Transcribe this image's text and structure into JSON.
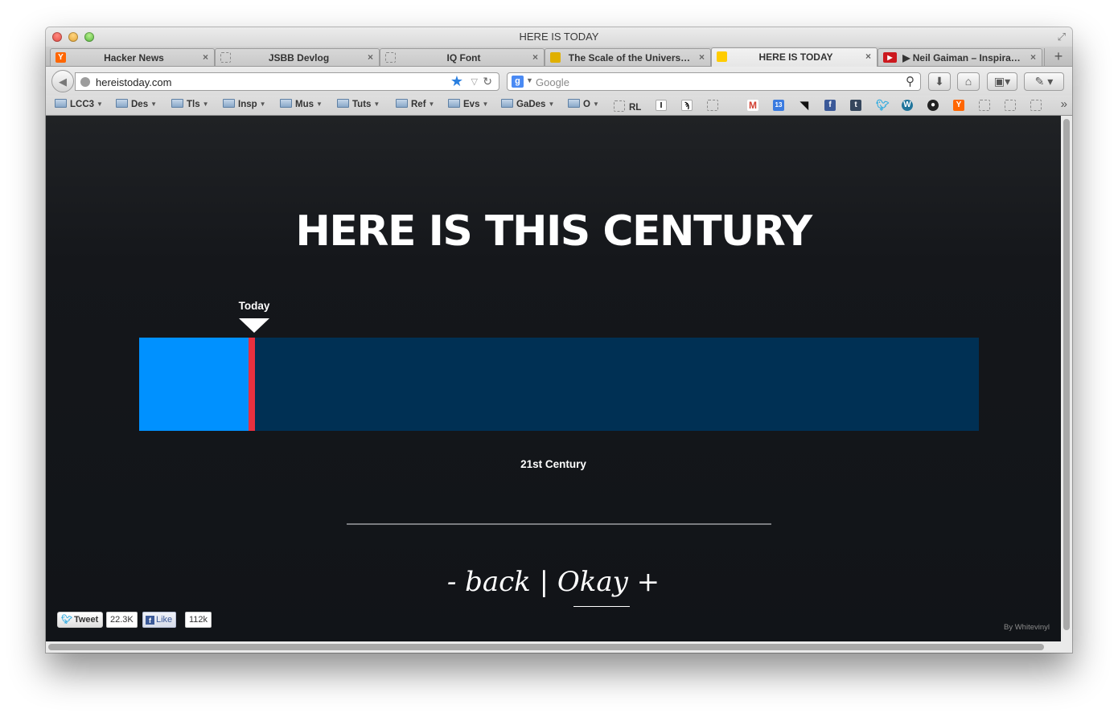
{
  "window": {
    "title": "HERE IS TODAY"
  },
  "tabs": [
    {
      "label": "Hacker News",
      "favicon": "Y",
      "favicon_color": "#ff6600"
    },
    {
      "label": "JSBB Devlog",
      "favicon": "",
      "favicon_color": ""
    },
    {
      "label": "IQ Font",
      "favicon": "",
      "favicon_color": ""
    },
    {
      "label": "The Scale of the Univers…",
      "favicon": "",
      "favicon_color": "#e0b000"
    },
    {
      "label": "HERE IS TODAY",
      "favicon": "",
      "favicon_color": "#ffcc00"
    },
    {
      "label": "▶ Neil Gaiman – Inspira…",
      "favicon": "▶",
      "favicon_color": "#cc181e"
    }
  ],
  "navbar": {
    "url": "hereistoday.com",
    "search_placeholder": "Google"
  },
  "bookmarks": {
    "folders": [
      "LCC3",
      "Des",
      "Tls",
      "Insp",
      "Mus",
      "Tuts",
      "Ref",
      "Evs",
      "GaDes",
      "O"
    ],
    "rl_label": "RL",
    "icons": [
      "instapaper-icon",
      "evernote-icon",
      "blank-icon",
      "gmail-icon",
      "calendar-icon",
      "rss-icon",
      "facebook-icon",
      "tumblr-icon",
      "twitter-icon",
      "wordpress-icon",
      "github-icon",
      "ycombinator-icon",
      "blank-icon",
      "blank-icon",
      "blank-icon"
    ],
    "calendar_day": "13"
  },
  "page": {
    "heading": "HERE IS THIS CENTURY",
    "today_label": "Today",
    "century_label": "21st Century",
    "progress_fraction": 0.13,
    "nav_back": "- back",
    "nav_separator": "|",
    "nav_okay": "Okay",
    "nav_plus": "+",
    "tweet_label": "Tweet",
    "tweet_count": "22.3K",
    "like_label": "Like",
    "like_count": "112k",
    "credit": "By Whitevinyl"
  },
  "colors": {
    "timeline_past": "#0091ff",
    "timeline_future": "#003054",
    "today_marker": "#e8303f",
    "background": "#111418"
  }
}
